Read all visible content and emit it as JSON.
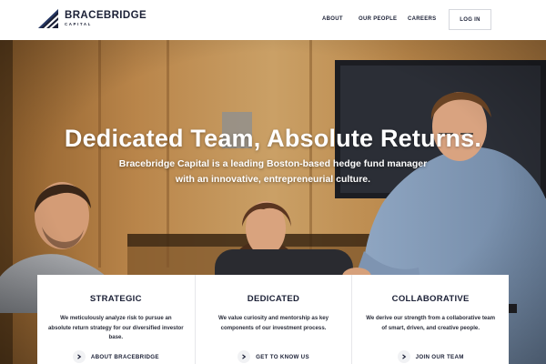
{
  "brand": {
    "name": "BRACEBRIDGE",
    "sub": "CAPITAL",
    "color": "#1b2036",
    "accent": "#2d4a8a"
  },
  "nav": {
    "items": [
      "ABOUT",
      "OUR PEOPLE",
      "CAREERS"
    ],
    "login_label": "LOG IN"
  },
  "hero": {
    "title": "Dedicated Team, Absolute Returns.",
    "subtitle": "Bracebridge Capital is a leading Boston-based hedge fund manager with an innovative, entrepreneurial culture."
  },
  "features": [
    {
      "title": "STRATEGIC",
      "text": "We meticulously analyze risk to pursue an absolute return strategy for our diversified investor base.",
      "link": "ABOUT BRACEBRIDGE",
      "icon": "chevron-right-icon"
    },
    {
      "title": "DEDICATED",
      "text": "We value curiosity and mentorship as key components of our investment process.",
      "link": "GET TO KNOW US",
      "icon": "chevron-right-icon"
    },
    {
      "title": "COLLABORATIVE",
      "text": "We derive our strength from a collaborative team of smart, driven, and creative people.",
      "link": "JOIN OUR TEAM",
      "icon": "chevron-right-icon"
    }
  ]
}
